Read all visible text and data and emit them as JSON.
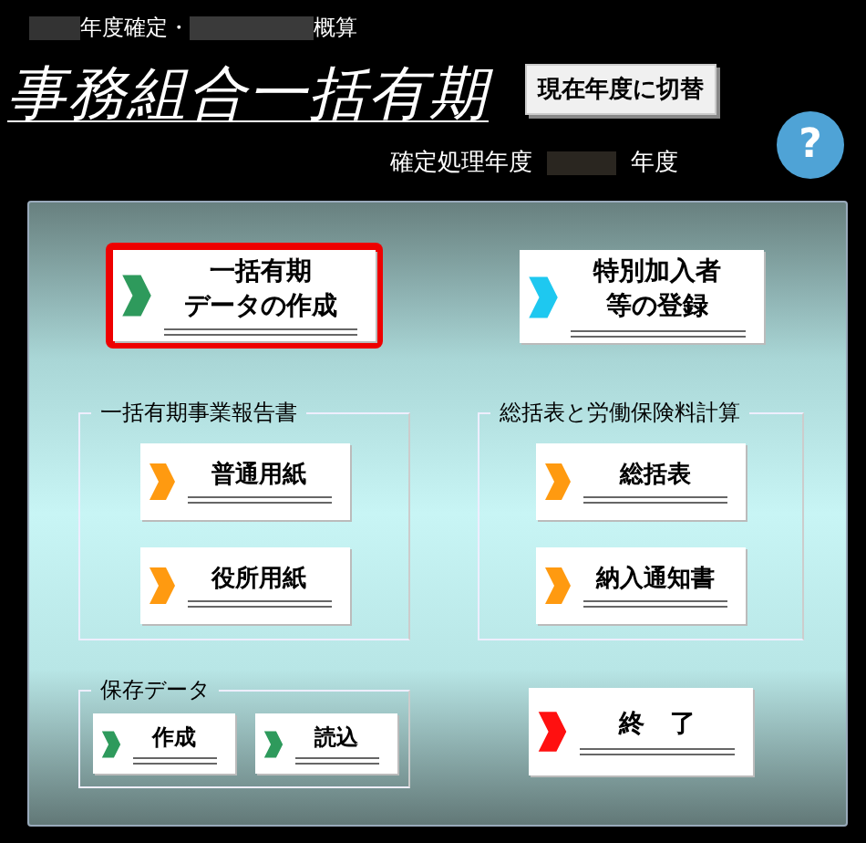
{
  "header": {
    "period_labels": [
      "年度確定・",
      "概算"
    ],
    "title": "事務組合一括有期",
    "switch_button": "現在年度に切替",
    "processing_year_label": "確定処理年度",
    "year_suffix": "年度",
    "help_button": "?"
  },
  "top_buttons": [
    {
      "lines": [
        "一括有期",
        "データの作成"
      ],
      "color": "#2e9a5c",
      "selected": true
    },
    {
      "lines": [
        "特別加入者",
        "等の登録"
      ],
      "color": "#1ec8f0",
      "selected": false
    }
  ],
  "groups": [
    {
      "title": "一括有期事業報告書",
      "buttons": [
        {
          "label": "普通用紙",
          "color": "#ff9a10"
        },
        {
          "label": "役所用紙",
          "color": "#ff9a10"
        }
      ]
    },
    {
      "title": "総括表と労働保険料計算",
      "buttons": [
        {
          "label": "総括表",
          "color": "#ff9a10"
        },
        {
          "label": "納入通知書",
          "color": "#ff9a10"
        }
      ]
    }
  ],
  "saved_data": {
    "title": "保存データ",
    "buttons": [
      {
        "label": "作成",
        "color": "#2e9a5c"
      },
      {
        "label": "読込",
        "color": "#2e9a5c"
      }
    ]
  },
  "exit_button": {
    "label": "終　了",
    "color": "#ff1010"
  }
}
